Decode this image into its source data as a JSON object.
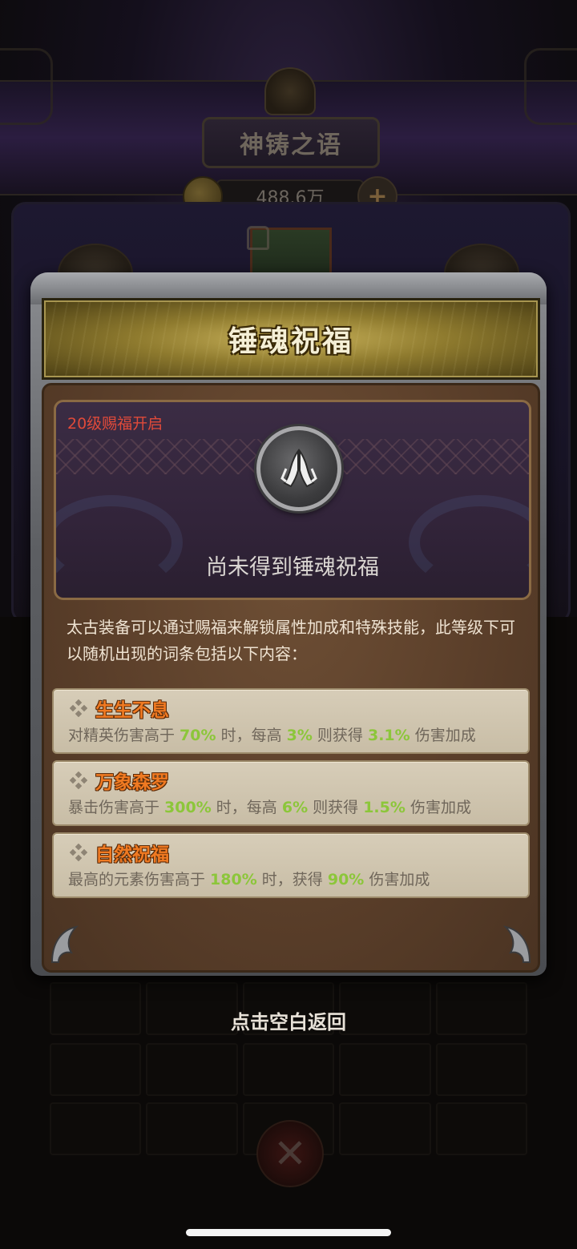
{
  "background": {
    "screen_title": "神铸之语",
    "currency_amount": "488.6万",
    "plus_label": "+"
  },
  "modal": {
    "title": "锤魂祝福",
    "unlock_level": "20级赐福开启",
    "status_text": "尚未得到锤魂祝福",
    "description": "太古装备可以通过赐福来解锁属性加成和特殊技能，此等级下可以随机出现的词条包括以下内容：",
    "affixes": [
      {
        "name": "生生不息",
        "effect": [
          {
            "t": "对精英伤害高于 "
          },
          {
            "t": "70%",
            "hl": true
          },
          {
            "t": " 时，每高 "
          },
          {
            "t": "3%",
            "hl": true
          },
          {
            "t": " 则获得 "
          },
          {
            "t": "3.1%",
            "hl": true
          },
          {
            "t": " 伤害加成"
          }
        ]
      },
      {
        "name": "万象森罗",
        "effect": [
          {
            "t": "暴击伤害高于 "
          },
          {
            "t": "300%",
            "hl": true
          },
          {
            "t": " 时，每高 "
          },
          {
            "t": "6%",
            "hl": true
          },
          {
            "t": " 则获得 "
          },
          {
            "t": "1.5%",
            "hl": true
          },
          {
            "t": " 伤害加成"
          }
        ]
      },
      {
        "name": "自然祝福",
        "effect": [
          {
            "t": "最高的元素伤害高于 "
          },
          {
            "t": "180%",
            "hl": true
          },
          {
            "t": " 时，获得 "
          },
          {
            "t": "90%",
            "hl": true
          },
          {
            "t": " 伤害加成"
          }
        ]
      }
    ]
  },
  "close_hint": "点击空白返回",
  "icons": {
    "bless": "praying-hands-icon",
    "affix_bullet": "diamond-cluster-icon"
  },
  "colors": {
    "unlock_level": "#e04a3a",
    "affix_name": "#f07a22",
    "highlight_value": "#8cc63a",
    "effect_text": "#6f665a"
  }
}
